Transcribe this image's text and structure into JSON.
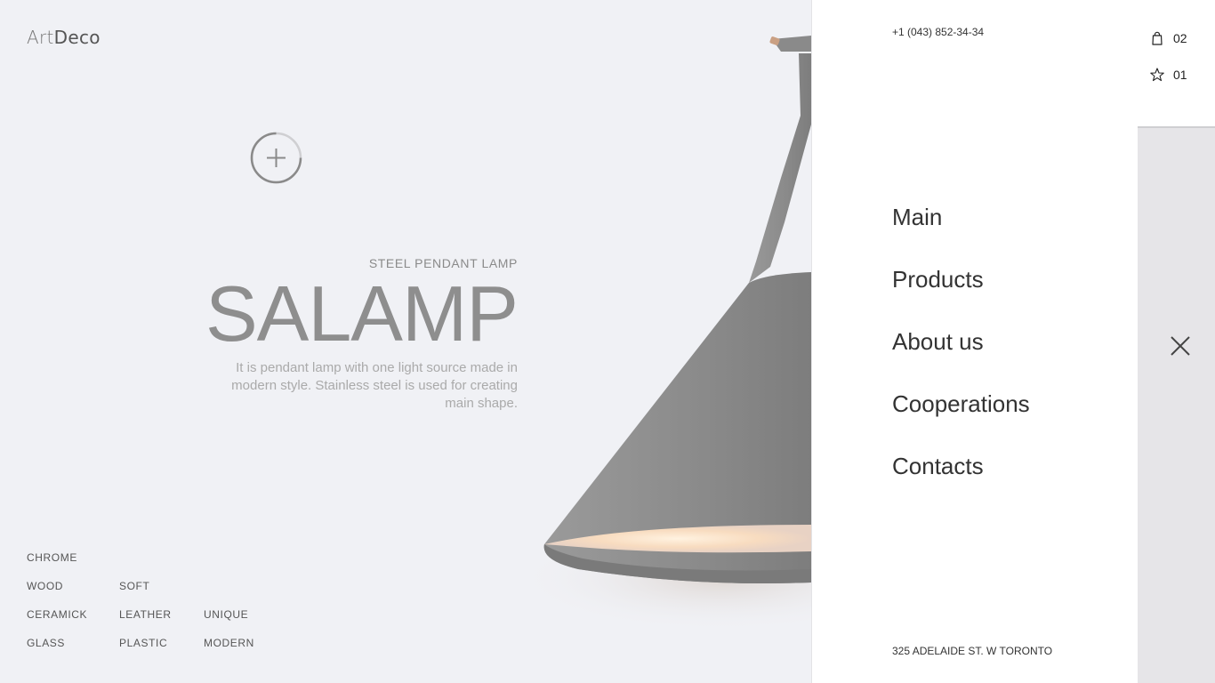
{
  "brand": {
    "logo_part1": "Art",
    "logo_part2": "Deco"
  },
  "product": {
    "subtitle": "STEEL PENDANT LAMP",
    "title": "SALAMP",
    "description": "It is pendant lamp with one light source made in modern style. Stainless steel is used for creating main shape."
  },
  "tags": [
    "CHROME",
    "WOOD",
    "SOFT",
    "CERAMICK",
    "LEATHER",
    "UNIQUE",
    "GLASS",
    "PLASTIC",
    "MODERN"
  ],
  "menu": {
    "phone": "+1 (043) 852-34-34",
    "items": [
      "Main",
      "Products",
      "About us",
      "Cooperations",
      "Contacts"
    ],
    "address": "325 ADELAIDE ST. W TORONTO"
  },
  "counters": {
    "cart": "02",
    "favorites": "01"
  },
  "icons": {
    "plus": "plus-circle-icon",
    "cart": "shopping-bag-icon",
    "favorites": "star-icon",
    "close": "close-icon"
  },
  "colors": {
    "hero_bg": "#f0f1f5",
    "lamp": "#8a8a8a",
    "panel_bg": "#ffffff",
    "strip_bg": "#e6e5e8"
  }
}
